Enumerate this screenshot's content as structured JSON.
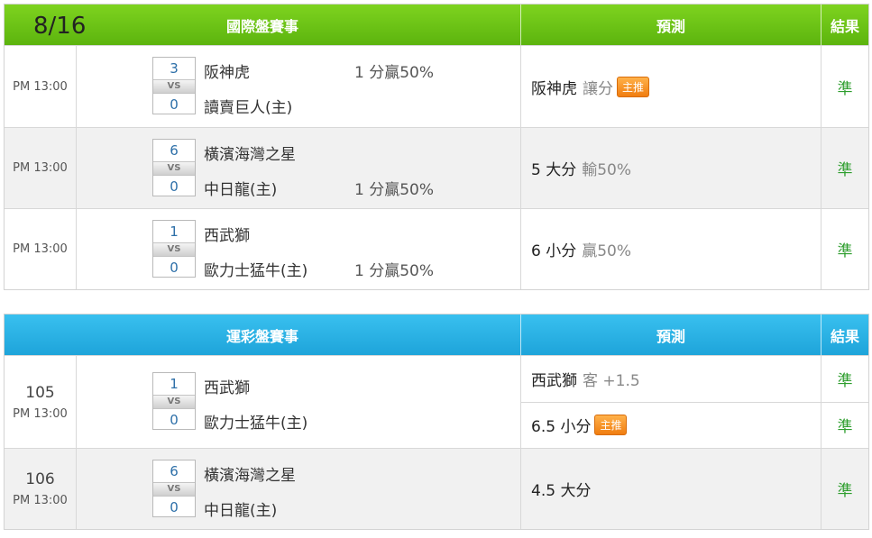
{
  "intl": {
    "date": "8/16",
    "header": {
      "title": "國際盤賽事",
      "pred": "預測",
      "result": "結果"
    },
    "rows": [
      {
        "time": "PM 13:00",
        "score1": "3",
        "vs": "VS",
        "score2": "0",
        "team1": "阪神虎",
        "team2": "讀賣巨人(主)",
        "odds": "1 分贏50%",
        "odds_row": 1,
        "pred_main": "阪神虎",
        "pred_sub": "讓分",
        "badge": "主推",
        "result": "準"
      },
      {
        "time": "PM 13:00",
        "score1": "6",
        "vs": "VS",
        "score2": "0",
        "team1": "橫濱海灣之星",
        "team2": "中日龍(主)",
        "odds": "1 分贏50%",
        "odds_row": 2,
        "pred_main": "5 大分",
        "pred_sub": "輸50%",
        "badge": "",
        "result": "準"
      },
      {
        "time": "PM 13:00",
        "score1": "1",
        "vs": "VS",
        "score2": "0",
        "team1": "西武獅",
        "team2": "歐力士猛牛(主)",
        "odds": "1 分贏50%",
        "odds_row": 2,
        "pred_main": "6 小分",
        "pred_sub": "贏50%",
        "badge": "",
        "result": "準"
      }
    ]
  },
  "lottery": {
    "header": {
      "title": "運彩盤賽事",
      "pred": "預測",
      "result": "結果"
    },
    "rows": [
      {
        "num": "105",
        "time": "PM 13:00",
        "score1": "1",
        "vs": "VS",
        "score2": "0",
        "team1": "西武獅",
        "team2": "歐力士猛牛(主)",
        "preds": [
          {
            "main": "西武獅",
            "sub": "客 +1.5",
            "badge": "",
            "result": "準"
          },
          {
            "main": "6.5 小分",
            "sub": "",
            "badge": "主推",
            "result": "準"
          }
        ]
      },
      {
        "num": "106",
        "time": "PM 13:00",
        "score1": "6",
        "vs": "VS",
        "score2": "0",
        "team1": "橫濱海灣之星",
        "team2": "中日龍(主)",
        "preds": [
          {
            "main": "4.5 大分",
            "sub": "",
            "badge": "",
            "result": "準"
          }
        ]
      }
    ]
  }
}
